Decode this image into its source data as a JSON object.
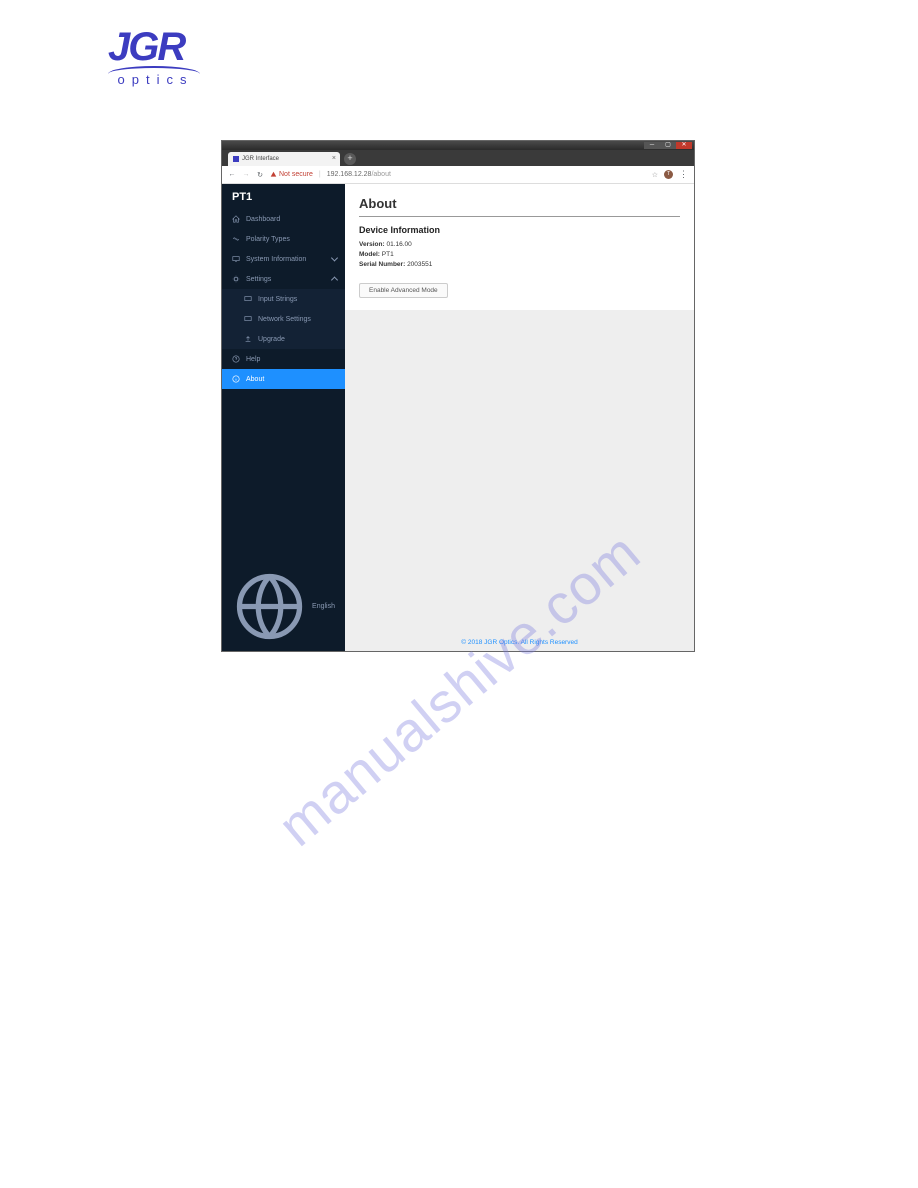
{
  "logo": {
    "main": "JGR",
    "sub": "optics"
  },
  "window": {
    "tab_title": "JGR Interface",
    "security_label": "Not secure",
    "url_host": "192.168.12.28",
    "url_path": "/about"
  },
  "sidebar": {
    "title": "PT1",
    "items": {
      "dashboard": "Dashboard",
      "polarity": "Polarity Types",
      "sysinfo": "System Information",
      "settings": "Settings",
      "input_strings": "Input Strings",
      "network": "Network Settings",
      "upgrade": "Upgrade",
      "help": "Help",
      "about": "About"
    },
    "language": "English"
  },
  "main": {
    "heading": "About",
    "section": "Device Information",
    "version_label": "Version:",
    "version_value": "01.16.00",
    "model_label": "Model:",
    "model_value": "PT1",
    "serial_label": "Serial Number:",
    "serial_value": "2003551",
    "advanced_btn": "Enable Advanced Mode"
  },
  "footer": "© 2018 JGR Optics. All Rights Reserved",
  "watermark": "manualshive.com"
}
